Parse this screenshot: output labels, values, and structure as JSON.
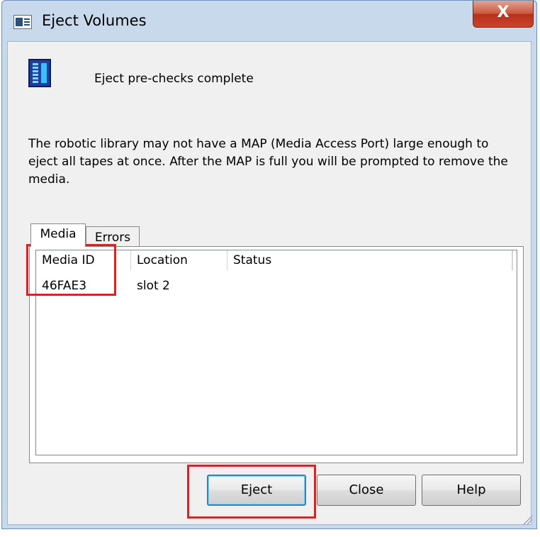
{
  "window": {
    "title": "Eject Volumes",
    "close_glyph": "X"
  },
  "status": {
    "message": "Eject pre-checks complete"
  },
  "notice": {
    "text": "The robotic library may not have a MAP (Media Access Port) large enough to eject all tapes at once.  After the MAP is full you will be prompted to remove the media."
  },
  "tabs": [
    {
      "label": "Media",
      "active": true
    },
    {
      "label": "Errors",
      "active": false
    }
  ],
  "table": {
    "columns": [
      "Media ID",
      "Location",
      "Status"
    ],
    "rows": [
      {
        "media_id": "46FAE3",
        "location": "slot 2",
        "status": ""
      }
    ]
  },
  "buttons": {
    "eject": "Eject",
    "close": "Close",
    "help": "Help"
  },
  "icons": {
    "window_icon": "window-app-icon",
    "library_icon": "tape-library-icon",
    "close_icon": "close-icon"
  },
  "colors": {
    "highlight": "#e02020",
    "titlebar": "#c9d9ec",
    "close_button": "#c8452d"
  }
}
